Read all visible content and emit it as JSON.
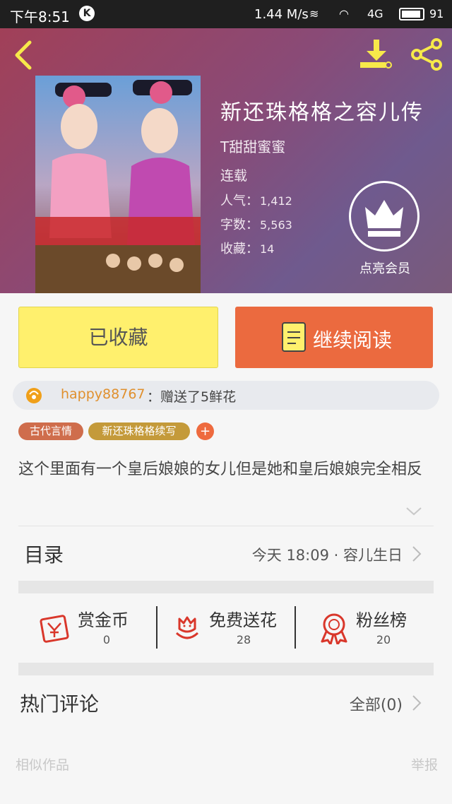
{
  "status_bar": {
    "time": "下午8:51",
    "k_badge": "K",
    "network_speed": "1.44 M/s",
    "signal_4g": "4G",
    "battery": "91"
  },
  "header": {
    "book_title": "新还珠格格之容儿传",
    "author": "T甜甜蜜蜜",
    "status": "连载",
    "stats": [
      {
        "label": "人气：",
        "value": "1,412"
      },
      {
        "label": "字数：",
        "value": "5,563"
      },
      {
        "label": "收藏：",
        "value": "14"
      }
    ],
    "vip_label": "点亮会员"
  },
  "actions": {
    "collected_label": "已收藏",
    "continue_label": "继续阅读"
  },
  "gift": {
    "user": "happy88767",
    "message": "：赠送了5鲜花"
  },
  "tags": [
    "古代言情",
    "新还珠格格续写"
  ],
  "tag_add": "+",
  "synopsis": "这个里面有一个皇后娘娘的女儿但是她和皇后娘娘完全相反",
  "toc": {
    "label": "目录",
    "latest": "今天 18:09 · 容儿生日"
  },
  "stats_row": [
    {
      "label": "赏金币",
      "value": "0",
      "icon": "red-envelope-icon"
    },
    {
      "label": "免费送花",
      "value": "28",
      "icon": "flower-icon"
    },
    {
      "label": "粉丝榜",
      "value": "20",
      "icon": "medal-icon"
    }
  ],
  "comments": {
    "label": "热门评论",
    "all_label": "全部(0)"
  },
  "footer": {
    "similar": "相似作品",
    "report": "举报"
  },
  "colors": {
    "accent_orange": "#eb6a3f",
    "collected_yellow": "#fff06d",
    "icon_red": "#d9372b",
    "header_gradient_start": "#a14058"
  }
}
